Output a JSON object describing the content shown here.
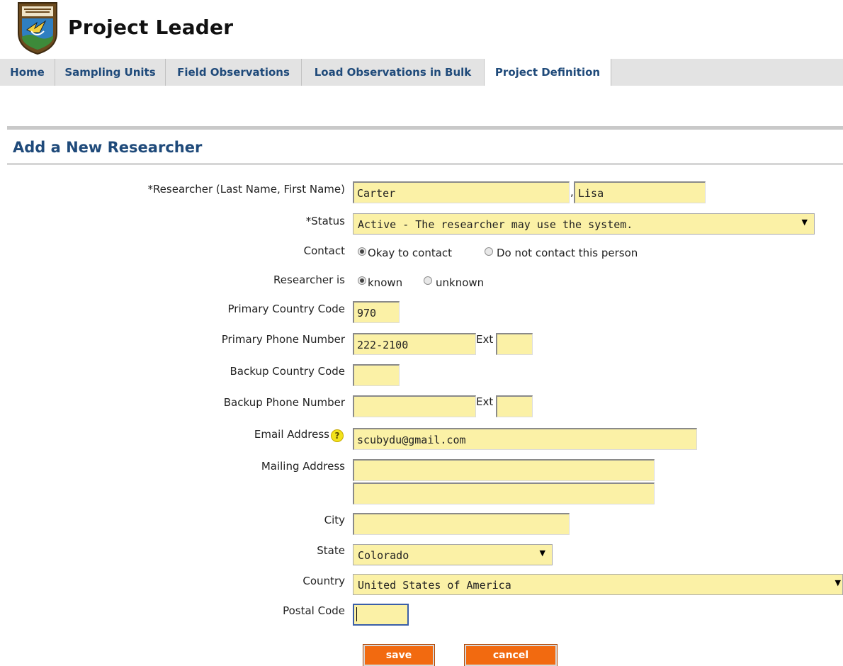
{
  "header": {
    "app_title": "Project Leader",
    "logo_icon": "agency-emblem-icon"
  },
  "nav": {
    "tabs": [
      {
        "label": "Home",
        "active": false
      },
      {
        "label": "Sampling Units",
        "active": false
      },
      {
        "label": "Field Observations",
        "active": false
      },
      {
        "label": "Load Observations in Bulk",
        "active": false
      },
      {
        "label": "Project Definition",
        "active": true
      }
    ]
  },
  "page": {
    "section_title": "Add a New Researcher"
  },
  "form": {
    "researcher": {
      "label": "*Researcher (Last Name, First Name)",
      "last_name": "Carter",
      "separator": ",",
      "first_name": "Lisa"
    },
    "status": {
      "label": "*Status",
      "value": "Active - The researcher may use the system."
    },
    "contact": {
      "label": "Contact",
      "options": [
        "Okay to contact",
        "Do not contact this person"
      ],
      "selected": "Okay to contact"
    },
    "researcher_is": {
      "label": "Researcher is",
      "options": [
        "known",
        "unknown"
      ],
      "selected": "known"
    },
    "primary_country_code": {
      "label": "Primary Country Code",
      "value": "970"
    },
    "primary_phone": {
      "label": "Primary Phone Number",
      "value": "222-2100",
      "ext_label": "Ext",
      "ext_value": ""
    },
    "backup_country_code": {
      "label": "Backup Country Code",
      "value": ""
    },
    "backup_phone": {
      "label": "Backup Phone Number",
      "value": "",
      "ext_label": "Ext",
      "ext_value": ""
    },
    "email": {
      "label": "Email Address",
      "value": "scubydu@gmail.com",
      "help_icon": "help-question-icon",
      "help_glyph": "?"
    },
    "mailing_address": {
      "label": "Mailing Address",
      "line1": "",
      "line2": ""
    },
    "city": {
      "label": "City",
      "value": ""
    },
    "state": {
      "label": "State",
      "value": "Colorado"
    },
    "country": {
      "label": "Country",
      "value": "United States of America"
    },
    "postal_code": {
      "label": "Postal Code",
      "value": ""
    }
  },
  "actions": {
    "save_label": "save",
    "cancel_label": "cancel"
  },
  "colors": {
    "input_bg": "#fbf1a6",
    "accent_button": "#f26a10",
    "heading_blue": "#1f4a7a",
    "tabbar_bg": "#e3e3e3"
  }
}
